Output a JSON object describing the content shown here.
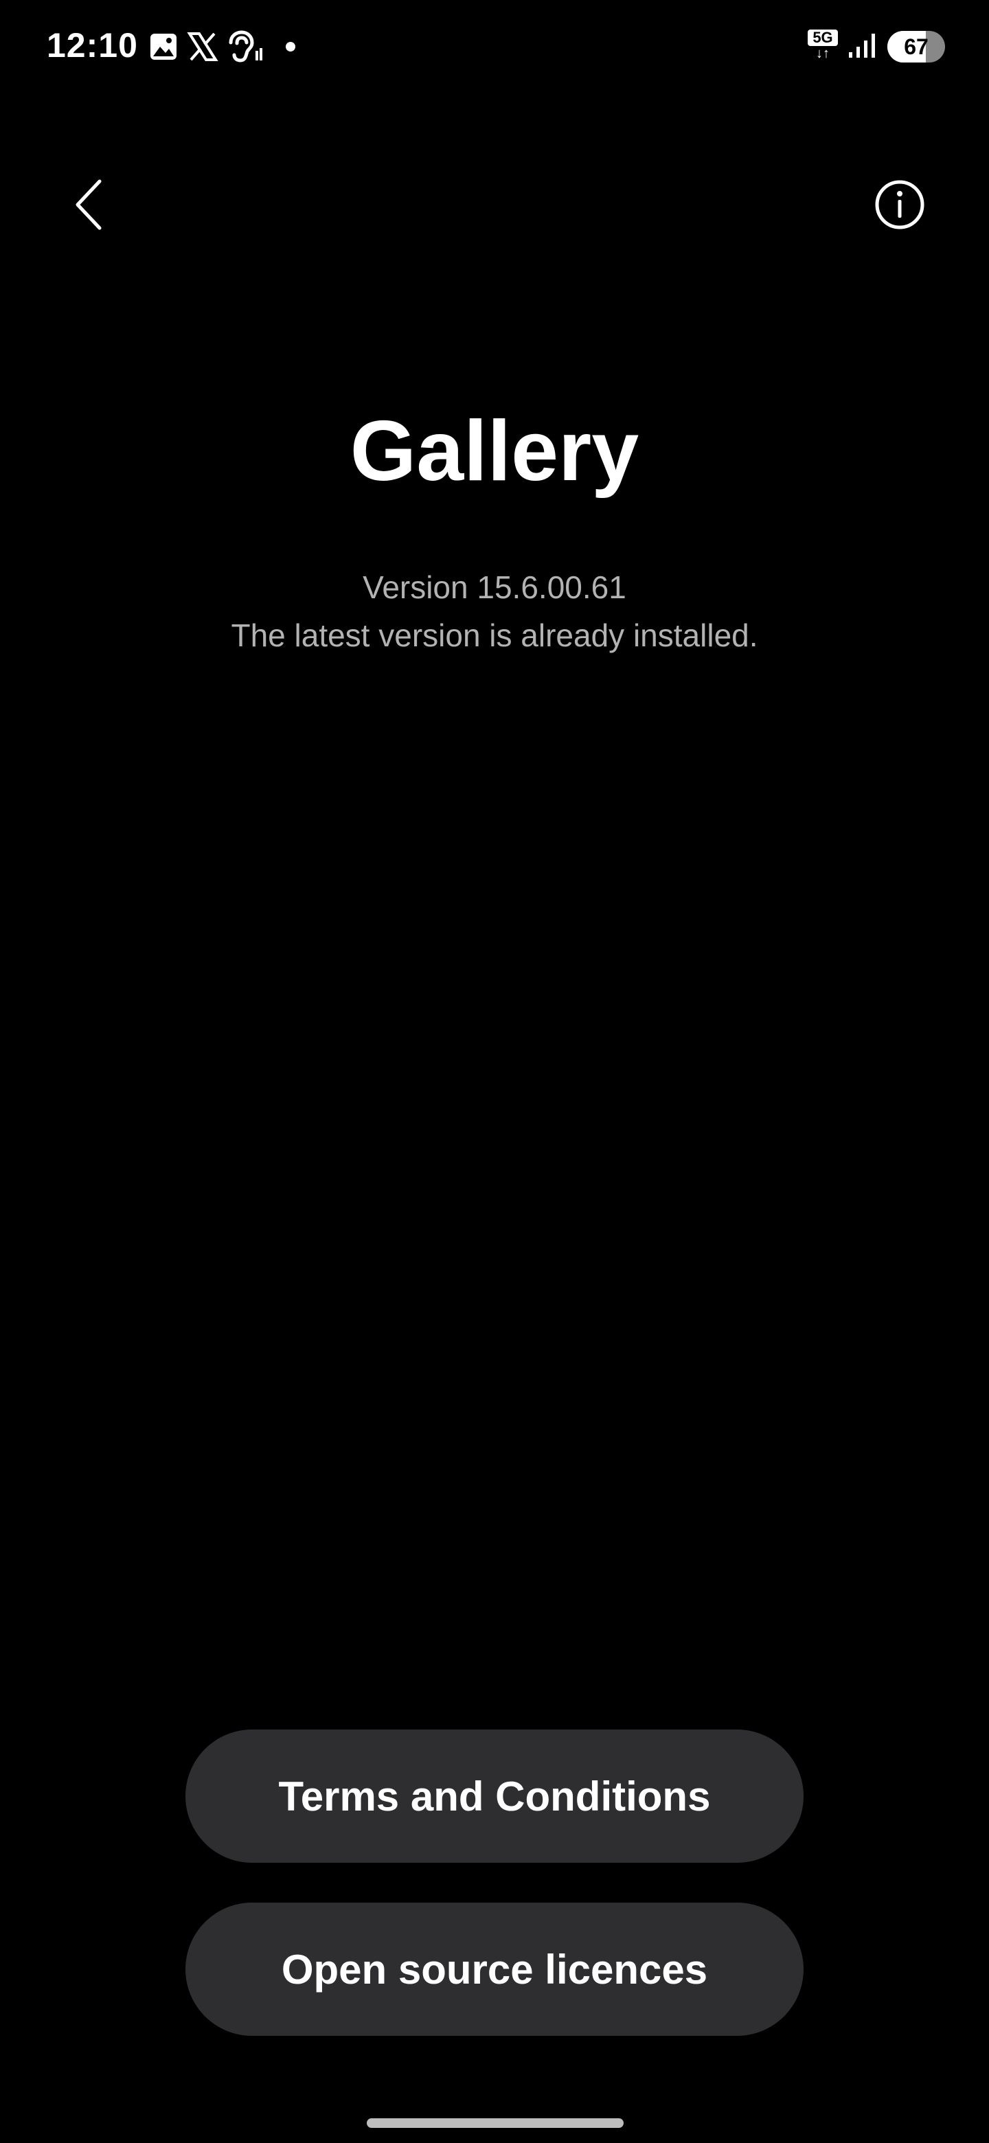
{
  "status_bar": {
    "time": "12:10",
    "network": "5G",
    "network_arrows": "↓↑",
    "battery_level": "67",
    "battery_fraction": 0.67,
    "left_icons": [
      "gallery-notification-icon",
      "x-notification-icon",
      "hearing-icon",
      "notification-dot"
    ],
    "right_icons": [
      "5g-icon",
      "signal-icon",
      "battery-icon"
    ]
  },
  "top_bar": {
    "back_icon": "chevron-left-icon",
    "info_icon": "info-icon"
  },
  "app": {
    "title": "Gallery",
    "version": "Version 15.6.00.61",
    "update_status": "The latest version is already installed."
  },
  "buttons": {
    "terms": "Terms and Conditions",
    "open_source": "Open source licences"
  },
  "colors": {
    "background": "#000000",
    "text_primary": "#ffffff",
    "text_secondary": "#b3b3b3",
    "button_background": "#2e2e30"
  }
}
